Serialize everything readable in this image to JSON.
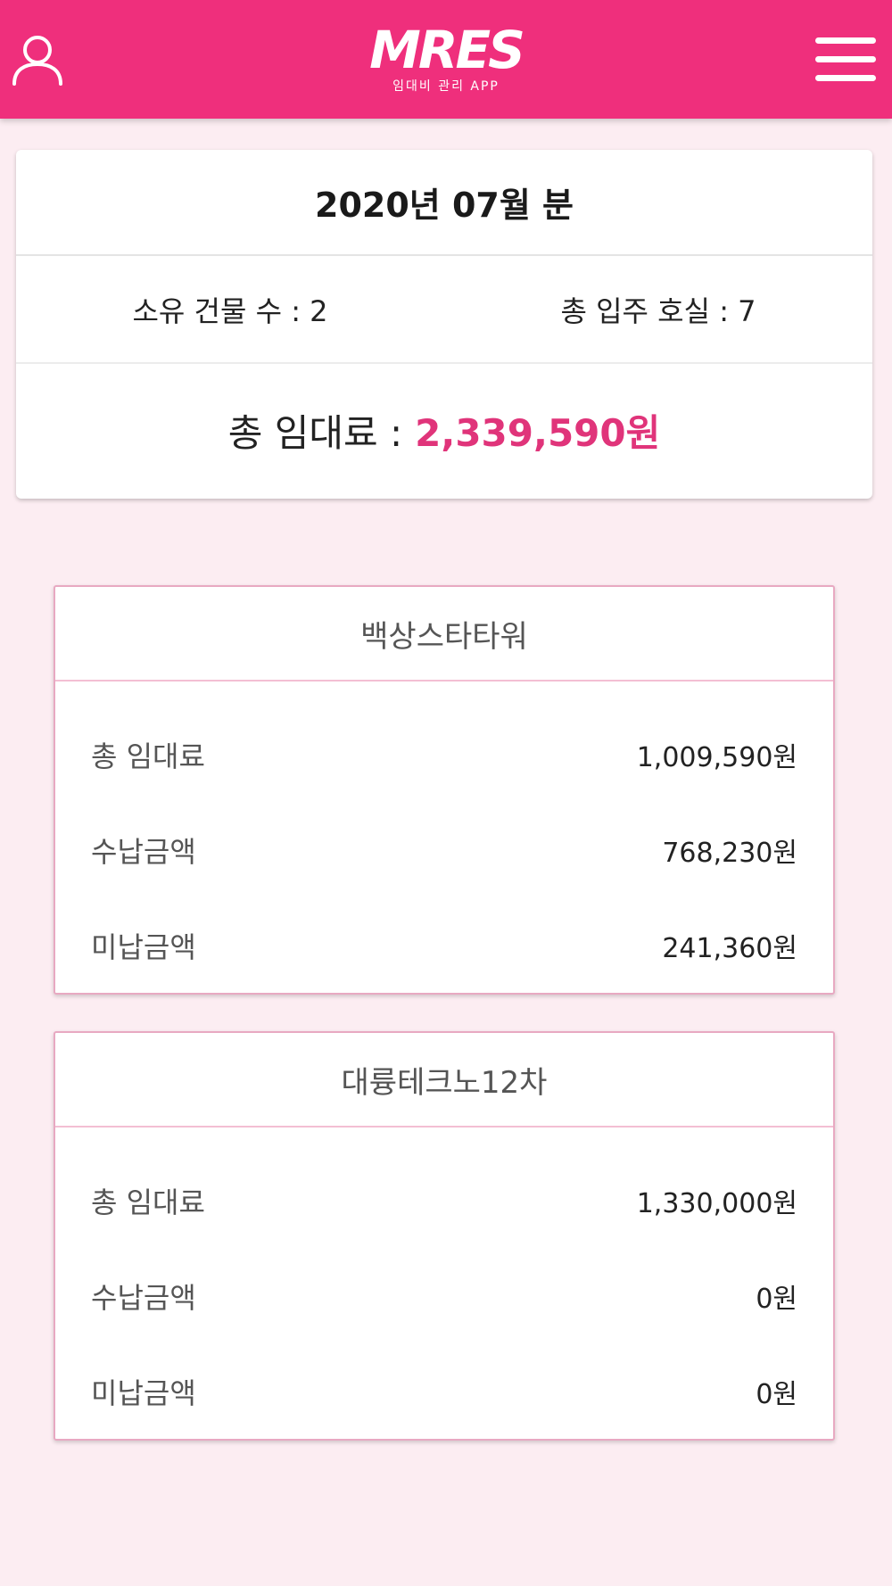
{
  "header": {
    "logo_text": "MRES",
    "logo_subtitle": "임대비 관리 APP",
    "profile_icon": "user-icon",
    "menu_icon": "hamburger-menu-icon",
    "background_color": "#ef2f7c"
  },
  "summary": {
    "period": "2020년 07월 분",
    "buildings_count_label": "소유 건물 수 : 2",
    "occupied_units_label": "총 입주 호실 : 7",
    "total_rent_label": "총 임대료 :",
    "total_rent_amount": "2,339,590원",
    "accent_color": "#e0347a"
  },
  "buildings": [
    {
      "name": "백상스타타워",
      "rows": [
        {
          "label": "총 임대료",
          "value": "1,009,590원"
        },
        {
          "label": "수납금액",
          "value": "768,230원"
        },
        {
          "label": "미납금액",
          "value": "241,360원"
        }
      ]
    },
    {
      "name": "대륭테크노12차",
      "rows": [
        {
          "label": "총 임대료",
          "value": "1,330,000원"
        },
        {
          "label": "수납금액",
          "value": "0원"
        },
        {
          "label": "미납금액",
          "value": "0원"
        }
      ]
    }
  ]
}
